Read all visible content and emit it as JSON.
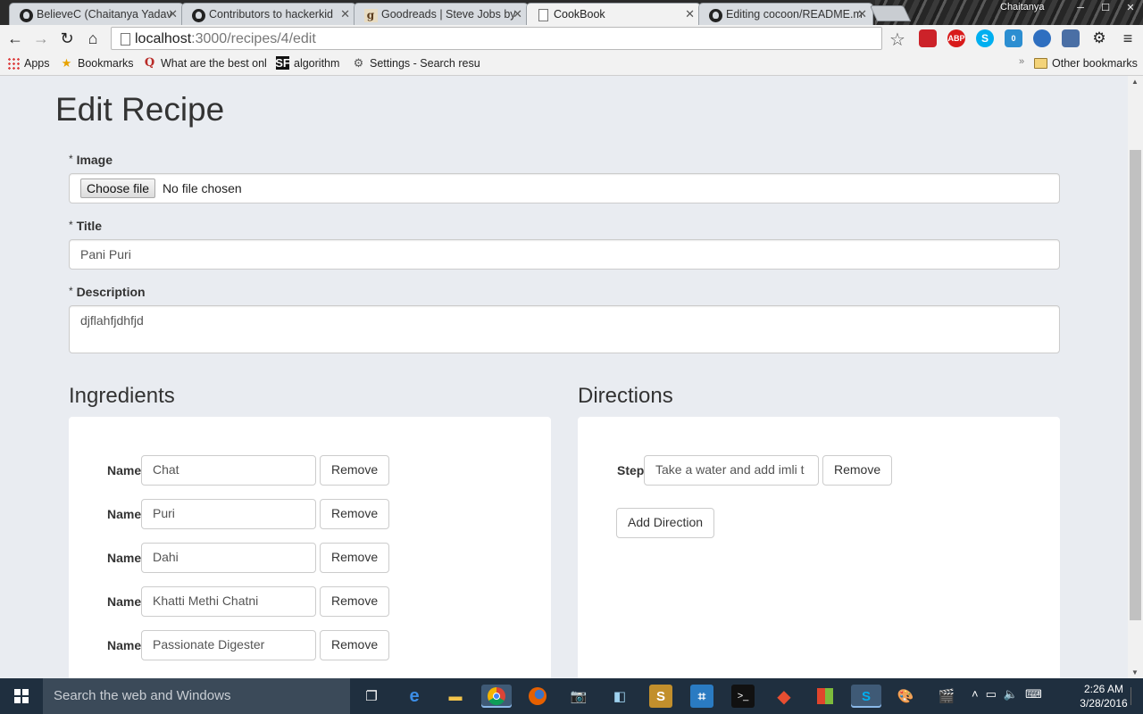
{
  "browser": {
    "tabs": [
      {
        "title": "BelieveC (Chaitanya Yadav",
        "icon": "github-icon",
        "active": false
      },
      {
        "title": "Contributors to hackerkid",
        "icon": "github-icon",
        "active": false
      },
      {
        "title": "Goodreads | Steve Jobs by",
        "icon": "goodreads-icon",
        "active": false
      },
      {
        "title": "CookBook",
        "icon": "page-icon",
        "active": true
      },
      {
        "title": "Editing cocoon/README.m",
        "icon": "github-icon",
        "active": false
      }
    ],
    "profile_name": "Chaitanya",
    "url_host": "localhost",
    "url_path": ":3000/recipes/4/edit",
    "extensions": [
      {
        "name": "lastpass-icon",
        "label": "",
        "color": "#cc2229"
      },
      {
        "name": "adblock-icon",
        "label": "ABP",
        "color": "#d81b1b"
      },
      {
        "name": "skype-icon",
        "label": "S",
        "color": "#00aff0"
      },
      {
        "name": "ghostery-icon",
        "label": "0",
        "color": "#2c8ed1"
      },
      {
        "name": "history-icon",
        "label": "",
        "color": "#2f6fc0"
      },
      {
        "name": "download-icon",
        "label": "",
        "color": "#4a6fa5"
      }
    ]
  },
  "bookmarks": {
    "items": [
      {
        "label": "Apps",
        "icon": "apps-icon"
      },
      {
        "label": "Bookmarks",
        "icon": "star-icon"
      },
      {
        "label": "What are the best onl",
        "icon": "quora-icon"
      },
      {
        "label": "algorithm",
        "icon": "sf-icon"
      },
      {
        "label": "Settings - Search resu",
        "icon": "gear-icon"
      }
    ],
    "other": "Other bookmarks"
  },
  "page": {
    "title": "Edit Recipe",
    "required_mark": "*",
    "image": {
      "label": "Image",
      "button": "Choose file",
      "status": "No file chosen"
    },
    "title_field": {
      "label": "Title",
      "value": "Pani Puri"
    },
    "description_field": {
      "label": "Description",
      "value": "djflahfjdhfjd"
    },
    "ingredients": {
      "heading": "Ingredients",
      "row_label": "Name",
      "remove_label": "Remove",
      "items": [
        "Chat",
        "Puri",
        "Dahi",
        "Khatti Methi Chatni",
        "Passionate Digester"
      ]
    },
    "directions": {
      "heading": "Directions",
      "row_label": "Step",
      "remove_label": "Remove",
      "items": [
        "Take a water and add imli t"
      ],
      "add_label": "Add Direction"
    }
  },
  "taskbar": {
    "search_placeholder": "Search the web and Windows",
    "time": "2:26 AM",
    "date": "3/28/2016"
  }
}
